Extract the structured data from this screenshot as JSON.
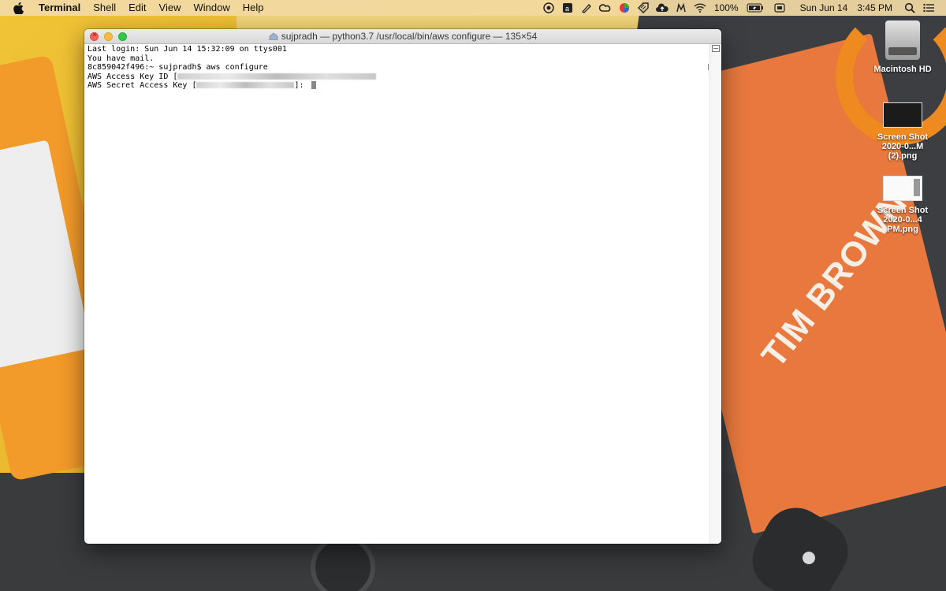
{
  "menubar": {
    "app_name": "Terminal",
    "menus": [
      "Shell",
      "Edit",
      "View",
      "Window",
      "Help"
    ],
    "status_icons": [
      "dropbox-like-icon",
      "amazon-icon",
      "pen-icon",
      "creative-cloud-icon",
      "color-wheel-icon",
      "tags-icon",
      "cloud-upload-icon",
      "m-app-icon",
      "wifi-icon",
      "battery-icon",
      "keyboard-icon",
      "search-icon",
      "notification-center-icon"
    ],
    "battery_percent": "100%",
    "date": "Sun Jun 14",
    "time": "3:45 PM"
  },
  "desktop": {
    "icons": [
      {
        "label": "Macintosh HD",
        "type": "drive"
      },
      {
        "label": "Screen Shot 2020-0...M (2).png",
        "type": "screenshot"
      },
      {
        "label": "Screen Shot 2020-0...4 PM.png",
        "type": "screenshot"
      }
    ],
    "wallpaper_text": "TIM BROWN"
  },
  "terminal": {
    "title": "sujpradh — python3.7 /usr/local/bin/aws configure — 135×54",
    "lines": {
      "last_login": "Last login: Sun Jun 14 15:32:09 on ttys001",
      "mail": "You have mail.",
      "prompt": "8c859042f496:~ sujpradh$ aws configure",
      "access_key_label": "AWS Access Key ID [",
      "secret_key_label": "AWS Secret Access Key [",
      "secret_key_suffix": "]: "
    }
  },
  "colors": {
    "close": "#fc605c",
    "minimize": "#fdbc40",
    "maximize": "#34c84a",
    "terminal_bg": "#ffffff",
    "terminal_text": "#000000"
  }
}
